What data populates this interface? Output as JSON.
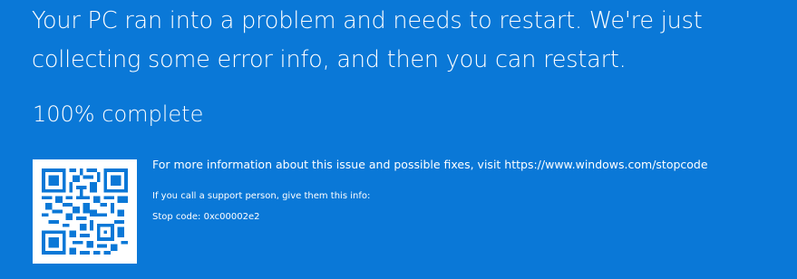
{
  "colors": {
    "background": "#0a78d7",
    "text": "#ffffff",
    "qr_dark": "#0a78d7",
    "qr_light": "#ffffff"
  },
  "error": {
    "headline": "Your PC ran into a problem and needs to restart. We're just collecting some error info, and then you can restart.",
    "progress": "100% complete"
  },
  "details": {
    "more_info": "For more information about this issue and possible fixes, visit https://www.windows.com/stopcode",
    "support": "If you call a support person, give them this info:",
    "stop_code": "Stop code: 0xc00002e2"
  },
  "qr_code": {
    "icon": "qr-code-icon"
  }
}
